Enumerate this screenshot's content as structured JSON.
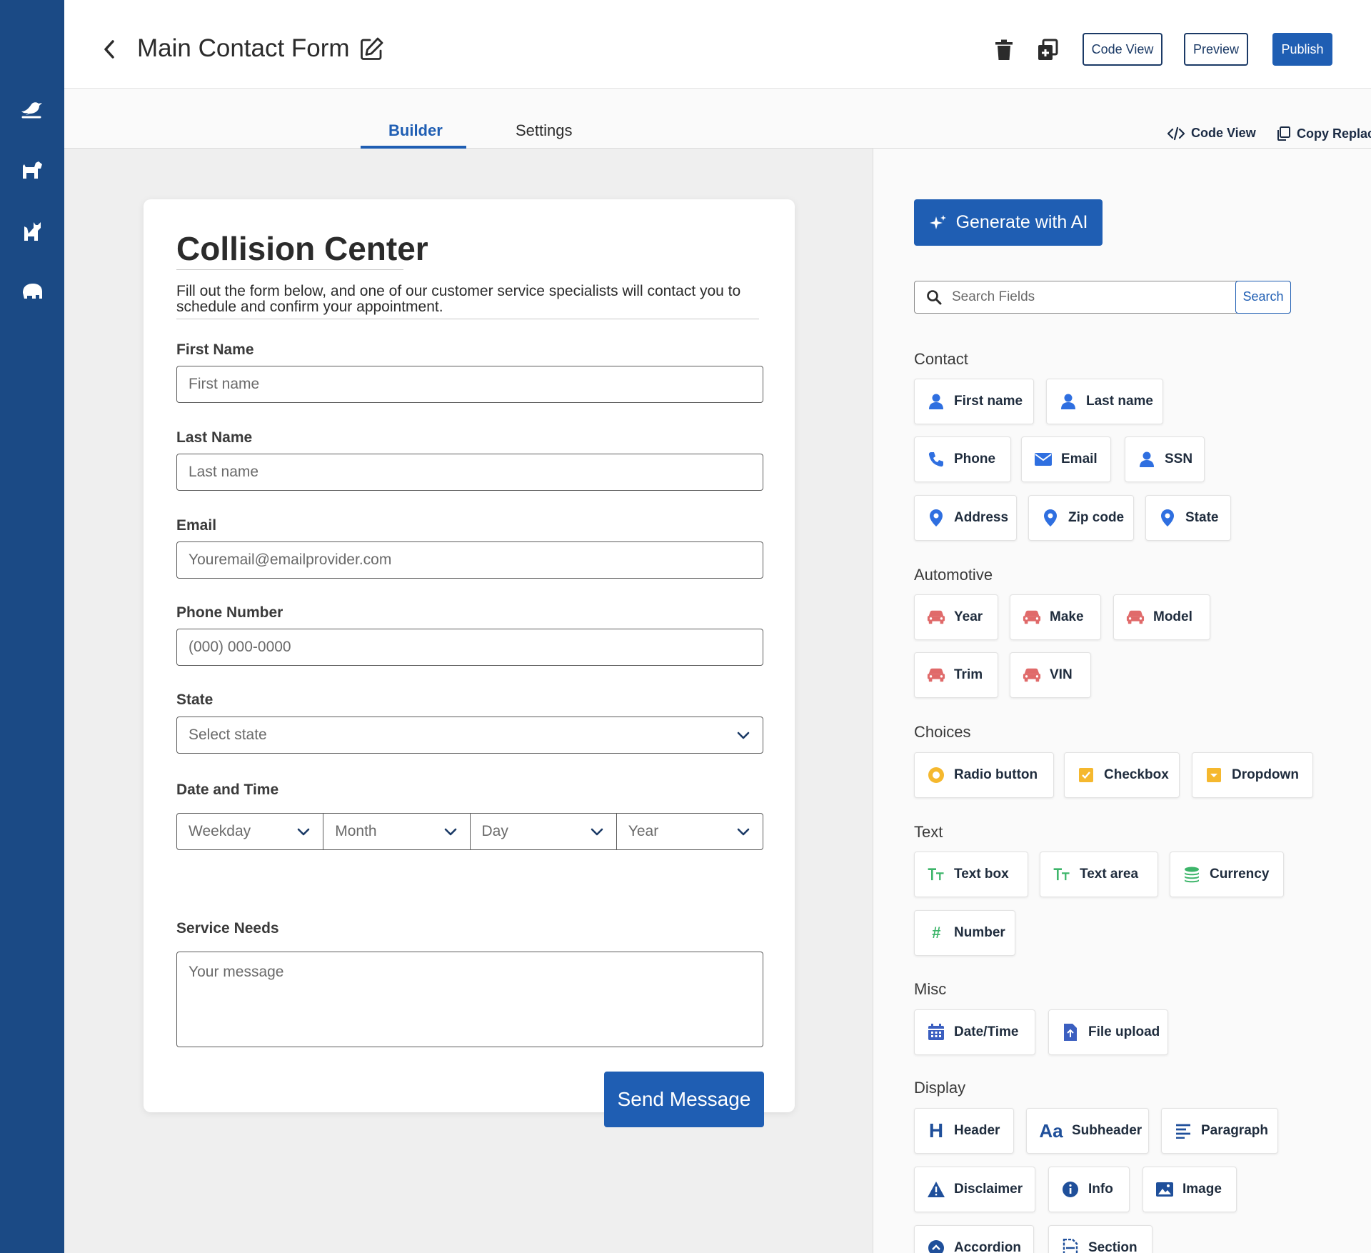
{
  "header": {
    "title": "Main Contact Form",
    "code_view": "Code View",
    "preview": "Preview",
    "publish": "Publish"
  },
  "tabs": {
    "builder": "Builder",
    "settings": "Settings",
    "code_view_link": "Code View",
    "copy_replace_link": "Copy Replace"
  },
  "rail": {
    "icons": [
      "bird-icon",
      "dog-icon",
      "cat-icon",
      "elephant-icon"
    ]
  },
  "form": {
    "title": "Collision Center",
    "description": "Fill out the form below, and one of our customer service specialists will contact you to schedule and confirm your appointment.",
    "first_name": {
      "label": "First Name",
      "placeholder": "First name"
    },
    "last_name": {
      "label": "Last Name",
      "placeholder": "Last name"
    },
    "email": {
      "label": "Email",
      "placeholder": "Youremail@emailprovider.com"
    },
    "phone": {
      "label": "Phone Number",
      "placeholder": "(000) 000-0000"
    },
    "state": {
      "label": "State",
      "placeholder": "Select state"
    },
    "datetime": {
      "label": "Date and Time",
      "weekday": "Weekday",
      "month": "Month",
      "day": "Day",
      "year": "Year"
    },
    "service": {
      "label": "Service Needs",
      "placeholder": "Your message"
    },
    "submit": "Send Message"
  },
  "panel": {
    "ai_button": "Generate with AI",
    "search_placeholder": "Search Fields",
    "search_button": "Search",
    "sections": {
      "contact": "Contact",
      "automotive": "Automotive",
      "choices": "Choices",
      "text": "Text",
      "misc": "Misc",
      "display": "Display"
    },
    "chips": {
      "first_name": "First name",
      "last_name": "Last name",
      "phone": "Phone",
      "email": "Email",
      "ssn": "SSN",
      "address": "Address",
      "zip": "Zip code",
      "state": "State",
      "year": "Year",
      "make": "Make",
      "model": "Model",
      "trim": "Trim",
      "vin": "VIN",
      "radio": "Radio button",
      "checkbox": "Checkbox",
      "dropdown": "Dropdown",
      "textbox": "Text box",
      "textarea": "Text area",
      "currency": "Currency",
      "number": "Number",
      "datetime": "Date/Time",
      "fileupload": "File upload",
      "header": "Header",
      "subheader": "Subheader",
      "paragraph": "Paragraph",
      "disclaimer": "Disclaimer",
      "info": "Info",
      "image": "Image",
      "accordion": "Accordion",
      "section": "Section"
    }
  },
  "colors": {
    "rail": "#1b4a85",
    "primary": "#1f5eb3",
    "contact_icon": "#2f6fe0",
    "automotive_icon": "#e06a6a",
    "choices_icon": "#f5b82e",
    "text_icon": "#3db56a",
    "display_icon": "#1f4f9a"
  }
}
